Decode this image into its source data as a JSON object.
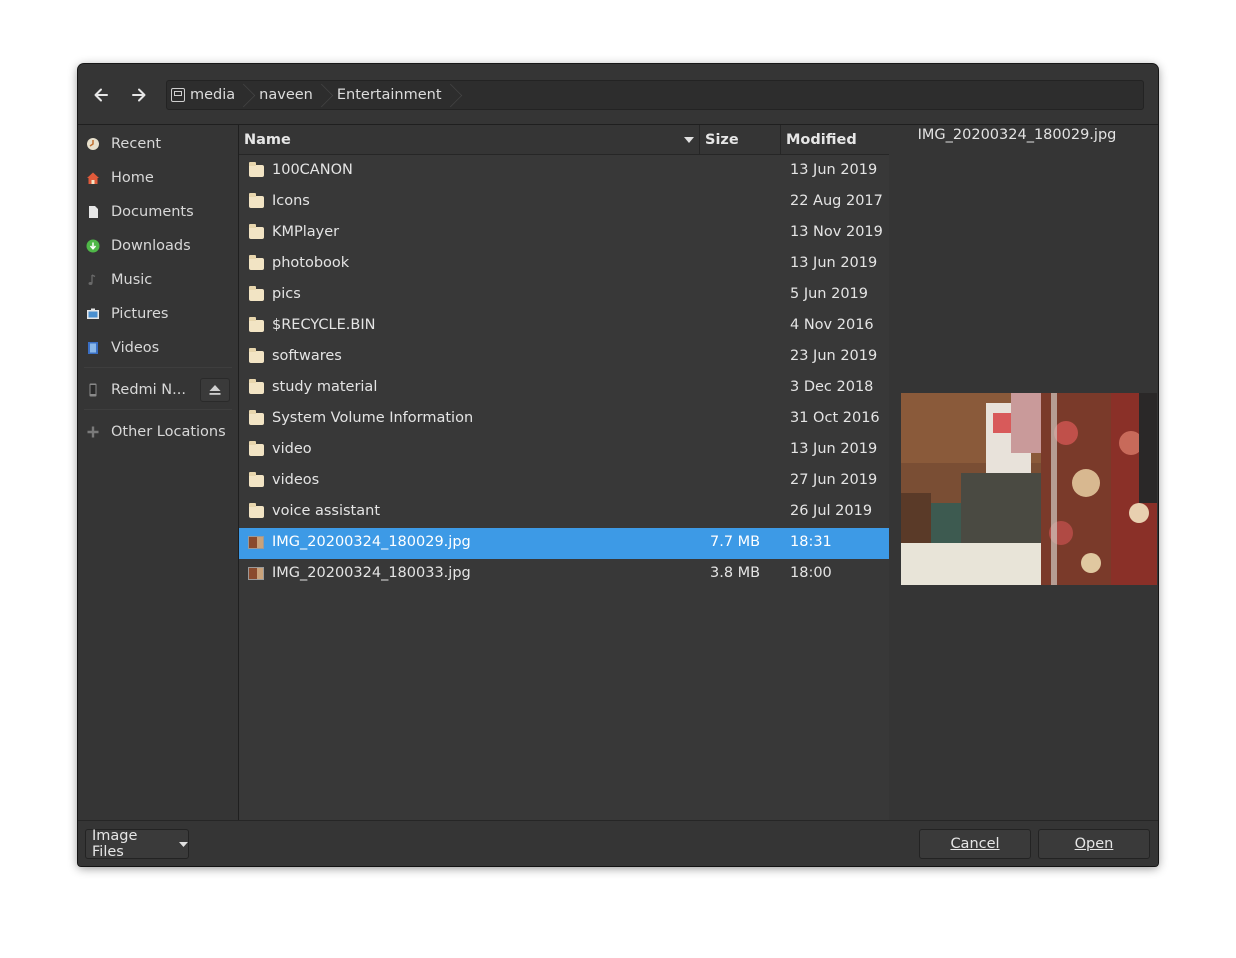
{
  "pathbar": {
    "crumbs": [
      "media",
      "naveen",
      "Entertainment"
    ]
  },
  "sidebar": {
    "items": [
      {
        "label": "Recent",
        "icon": "recent-icon"
      },
      {
        "label": "Home",
        "icon": "home-icon"
      },
      {
        "label": "Documents",
        "icon": "document-icon"
      },
      {
        "label": "Downloads",
        "icon": "download-icon"
      },
      {
        "label": "Music",
        "icon": "music-icon"
      },
      {
        "label": "Pictures",
        "icon": "pictures-icon"
      },
      {
        "label": "Videos",
        "icon": "videos-icon"
      }
    ],
    "device": {
      "label": "Redmi N...",
      "icon": "phone-icon"
    },
    "other": {
      "label": "Other Locations",
      "icon": "plus-icon"
    }
  },
  "columns": {
    "name": "Name",
    "size": "Size",
    "modified": "Modified"
  },
  "files": [
    {
      "name": "100CANON",
      "size": "",
      "modified": "13 Jun 2019",
      "type": "folder"
    },
    {
      "name": "Icons",
      "size": "",
      "modified": "22 Aug 2017",
      "type": "folder"
    },
    {
      "name": "KMPlayer",
      "size": "",
      "modified": "13 Nov 2019",
      "type": "folder"
    },
    {
      "name": "photobook",
      "size": "",
      "modified": "13 Jun 2019",
      "type": "folder"
    },
    {
      "name": "pics",
      "size": "",
      "modified": "5 Jun 2019",
      "type": "folder"
    },
    {
      "name": "$RECYCLE.BIN",
      "size": "",
      "modified": "4 Nov 2016",
      "type": "folder"
    },
    {
      "name": "softwares",
      "size": "",
      "modified": "23 Jun 2019",
      "type": "folder"
    },
    {
      "name": "study material",
      "size": "",
      "modified": "3 Dec 2018",
      "type": "folder"
    },
    {
      "name": "System Volume Information",
      "size": "",
      "modified": "31 Oct 2016",
      "type": "folder"
    },
    {
      "name": "video",
      "size": "",
      "modified": "13 Jun 2019",
      "type": "folder"
    },
    {
      "name": "videos",
      "size": "",
      "modified": "27 Jun 2019",
      "type": "folder"
    },
    {
      "name": "voice assistant",
      "size": "",
      "modified": "26 Jul 2019",
      "type": "folder"
    },
    {
      "name": "IMG_20200324_180029.jpg",
      "size": "7.7 MB",
      "modified": "18:31",
      "type": "image",
      "selected": true
    },
    {
      "name": "IMG_20200324_180033.jpg",
      "size": "3.8 MB",
      "modified": "18:00",
      "type": "image"
    }
  ],
  "preview": {
    "filename": "IMG_20200324_180029.jpg"
  },
  "footer": {
    "filter": "Image Files",
    "cancel_label": "Cancel",
    "open_label": "Open"
  },
  "colors": {
    "selection": "#3d9ae6",
    "background": "#353535",
    "list_background": "#383838"
  }
}
